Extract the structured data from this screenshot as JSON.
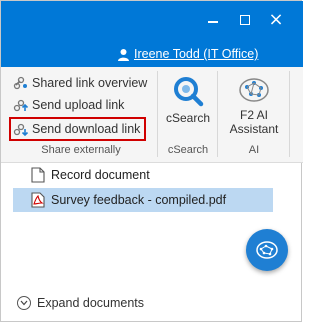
{
  "header": {
    "user_name": "Ireene Todd (IT Office)"
  },
  "ribbon": {
    "share_items": [
      {
        "label": "Shared link overview"
      },
      {
        "label": "Send upload link"
      },
      {
        "label": "Send download link"
      }
    ],
    "share_group_label": "Share externally",
    "csearch_label": "cSearch",
    "csearch_group_label": "cSearch",
    "ai_button_label_line1": "F2 AI",
    "ai_button_label_line2": "Assistant",
    "ai_group_label": "AI"
  },
  "documents": [
    {
      "name": "Record document",
      "icon": "blank-document-icon",
      "selected": false
    },
    {
      "name": "Survey feedback - compiled.pdf",
      "icon": "pdf-file-icon",
      "selected": true
    }
  ],
  "footer": {
    "expand_label": "Expand documents"
  },
  "colors": {
    "titlebar": "#0078d7",
    "highlight_border": "#d00000",
    "selection": "#bcd8f2",
    "fab": "#1f7fd3"
  }
}
